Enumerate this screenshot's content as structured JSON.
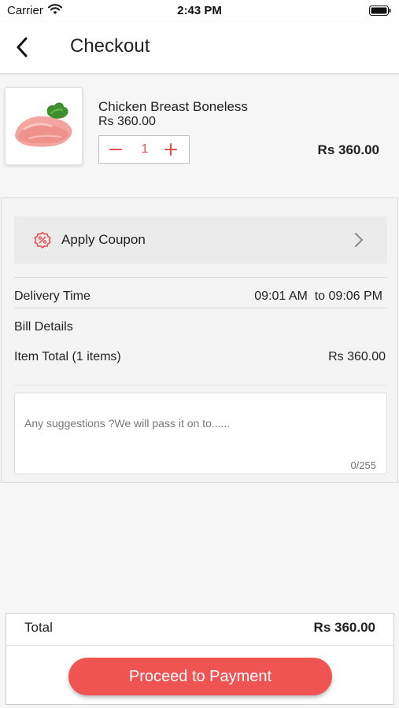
{
  "status_bar": {
    "carrier": "Carrier",
    "time": "2:43 PM"
  },
  "header": {
    "title": "Checkout"
  },
  "cart_item": {
    "name": "Chicken Breast Boneless",
    "unit_price": "Rs 360.00",
    "quantity": "1",
    "minus_symbol": "−",
    "plus_symbol": "+",
    "line_total": "Rs 360.00",
    "image_icon": "chicken-breast-image"
  },
  "coupon": {
    "label": "Apply Coupon",
    "icon": "discount-badge-icon"
  },
  "delivery": {
    "label": "Delivery Time",
    "value": "09:01 AM  to 09:06 PM"
  },
  "bill": {
    "label": "Bill Details",
    "item_total_label": "Item Total (1 items)",
    "item_total_value": "Rs 360.00"
  },
  "suggestions": {
    "placeholder": "Any suggestions ?We will pass it on to......",
    "counter": "0/255"
  },
  "footer": {
    "total_label": "Total",
    "total_value": "Rs 360.00",
    "proceed_label": "Proceed to Payment"
  },
  "colors": {
    "accent": "#f05452",
    "background": "#f6f6f6"
  }
}
